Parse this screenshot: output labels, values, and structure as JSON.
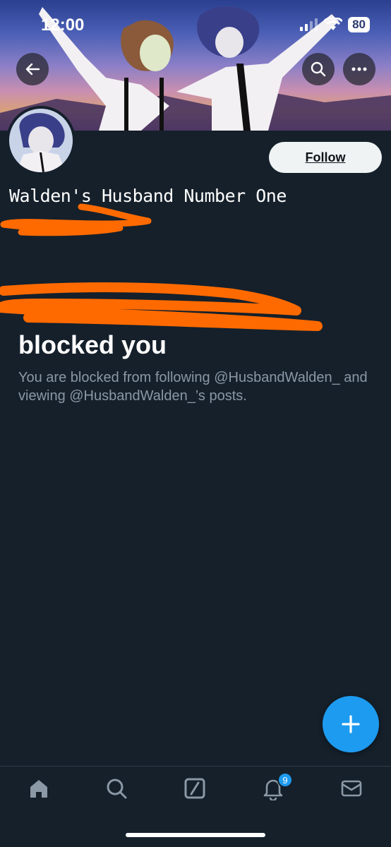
{
  "status_bar": {
    "time": "12:00",
    "battery": "80"
  },
  "profile": {
    "display_name": "Walden's Husband Number One",
    "follow_label": "Follow"
  },
  "blocked": {
    "title": "blocked you",
    "description": "You are blocked from following @HusbandWalden_ and viewing @HusbandWalden_’s posts."
  },
  "nav": {
    "items": [
      {
        "name": "home",
        "icon": "home-icon"
      },
      {
        "name": "search",
        "icon": "search-icon"
      },
      {
        "name": "grok",
        "icon": "grok-icon"
      },
      {
        "name": "notifications",
        "icon": "bell-icon",
        "badge": "9"
      },
      {
        "name": "messages",
        "icon": "mail-icon"
      }
    ]
  },
  "colors": {
    "background": "#15202b",
    "accent": "#1d9bf0",
    "redaction": "#ff6a00",
    "muted_text": "#8b98a5"
  }
}
